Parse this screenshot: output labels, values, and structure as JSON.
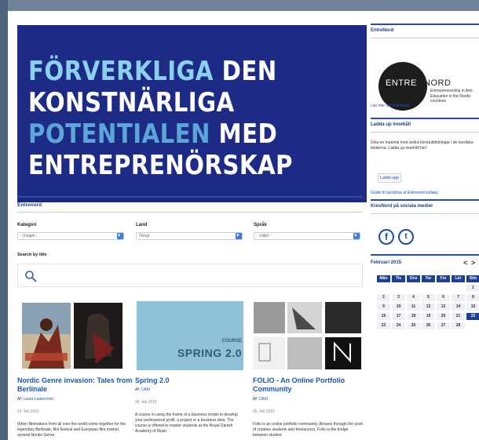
{
  "hero": {
    "line1_a": "FÖRVERKLIGA",
    "line1_b": "DEN",
    "line2": "KONSTNÄRLIGA",
    "line3_a": "POTENTIALEN",
    "line3_b": "MED",
    "line4": "ENTREPRENÖRSKAP"
  },
  "section_title": "Entrenord",
  "filters": [
    {
      "label": "Kategori",
      "value": "- Vsägel -"
    },
    {
      "label": "Land",
      "value": "Övrigt"
    },
    {
      "label": "Språk",
      "value": "- Väljel -"
    }
  ],
  "search": {
    "label": "Search by title"
  },
  "cards": [
    {
      "title": "Nordic Genre invasion: Tales from Berlinale",
      "author_prefix": "Af:",
      "author": "Laura Laaksonen",
      "date": "19. feb 2015",
      "excerpt": "When filmmakers from all over the world come together for the legendary Berlinale, film festival and European film market, several Nordic Genre"
    },
    {
      "title": "Spring 2.0",
      "author_prefix": "Af:",
      "author": "CAKI",
      "date": "09. feb 2015",
      "excerpt": "A course in using the frame of a business model to develop your professional profil, a project or a business idea. The course is offered to master students at the Royal Danish Academy of Music",
      "thumb_text_small": "COURSE",
      "thumb_text": "SPRING 2.0"
    },
    {
      "title": "FOLIO - An Online Portfolio Community",
      "author_prefix": "Af:",
      "author": "CAKI",
      "date": "05. feb 2015",
      "excerpt": "Folio is an online portfolio community. Browse through the work of creative students and freelancers. Folio is the bridge between student"
    }
  ],
  "sidebar": {
    "entrenord_head": "EntreNord",
    "logo_entre": "ENTRE",
    "logo_nord": "NORD",
    "logo_sub": "Entrepreneurship in Arts Education in the Nordic countries",
    "more_link": "Läs mer om Entrenord",
    "upload_head": "Ladda up innehåll",
    "upload_text": "Dela en material med andra konstutbildningar i de nordiska länderna. Ladda up innehåll her!",
    "upload_button": "Ladda upp",
    "upload_guide": "Guide til opslättsa af Entrenord indlæg",
    "social_head": "KresNord på sociala medier",
    "facebook_glyph": "f",
    "twitter_glyph": "t"
  },
  "calendar": {
    "month": "Februari 2015",
    "prev": "<",
    "next": ">",
    "days": [
      "Mån",
      "Tis",
      "Ons",
      "Tor",
      "Fre",
      "Lör",
      "Sön"
    ],
    "today": "22"
  },
  "colors": {
    "hero_bg": "#1d2a86",
    "accent_blue": "#1a54c0",
    "calendar_blue": "#1f3e96"
  }
}
